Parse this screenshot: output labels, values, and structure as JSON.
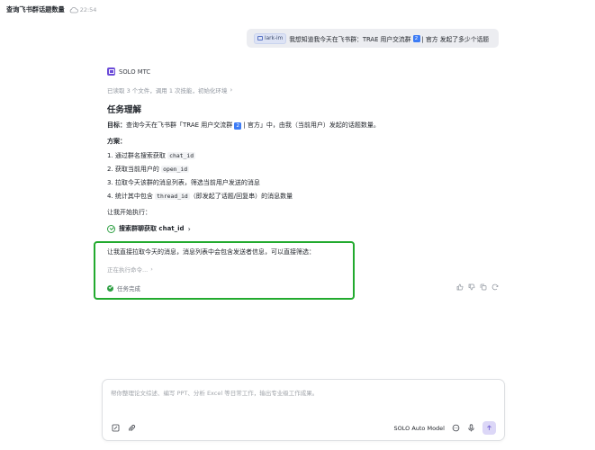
{
  "header": {
    "title": "查询飞书群话题数量",
    "time": "22:54",
    "sync_icon": "cloud-icon"
  },
  "user_message": {
    "chip_label": "lark-im",
    "text_before": "我想知道我今天在飞书群：TRAE 用户交流群",
    "badge": "2",
    "text_after": "| 官方 发起了多少个话题"
  },
  "agent": {
    "name": "SOLO MTC",
    "read_summary": "已读取 3 个文件，调用 1 次技能，初始化环境",
    "task_title": "任务理解",
    "goal_label": "目标：",
    "goal_before": "查询今天在飞书群「TRAE 用户交流群",
    "goal_badge": "2",
    "goal_after": "| 官方」中，由我（当前用户）发起的话题数量。",
    "plan_label": "方案：",
    "steps": [
      {
        "before": "1. 通过群名搜索获取 ",
        "code": "chat_id",
        "after": ""
      },
      {
        "before": "2. 获取当前用户的 ",
        "code": "open_id",
        "after": ""
      },
      {
        "before": "3. 拉取今天该群的消息列表，筛选当前用户发送的消息",
        "code": "",
        "after": ""
      },
      {
        "before": "4. 统计其中包含 ",
        "code": "thread_id",
        "after": "（即发起了话题/回复串）的消息数量"
      }
    ],
    "start_text": "让我开始执行：",
    "tool_call": "搜索群聊获取 chat_id",
    "followup": "让我直接拉取今天的消息，消息列表中会包含发送者信息，可以直接筛选：",
    "running": "正在执行命令...",
    "done": "任务完成"
  },
  "composer": {
    "placeholder": "帮你整理论文综述、编写 PPT、分析 Excel 等日常工作，输出专业级工作成果。",
    "model": "SOLO Auto Model"
  },
  "colors": {
    "highlight_border": "#22aa2e",
    "success": "#2ea043",
    "agent_logo": "#6b4bd8",
    "badge_blue": "#3d7cf5",
    "send_button": "#dcd7f7"
  }
}
